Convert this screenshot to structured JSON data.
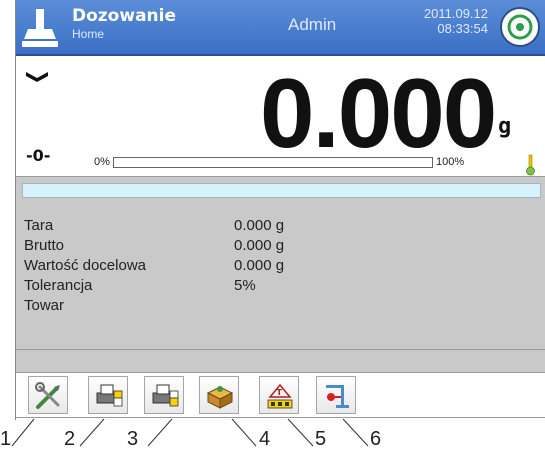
{
  "header": {
    "title": "Dozowanie",
    "subtitle": "Home",
    "user": "Admin",
    "date": "2011.09.12",
    "time": "08:33:54",
    "icon": "dosing-funnel-icon",
    "menu_button_icon": "target-icon",
    "bg_color": "#3a6fc4"
  },
  "display": {
    "weight": "0.000",
    "unit": "g",
    "zero_indicator": "-0-",
    "range_min": "0%",
    "range_max": "100%",
    "bar_level": 0.0,
    "stable_icon": "stability-marker-icon",
    "thermometer_icon": "thermometer-icon"
  },
  "info": {
    "progress_level": 0.0,
    "rows": [
      {
        "label": "Tara",
        "value": "0.000 g"
      },
      {
        "label": "Brutto",
        "value": "0.000 g"
      },
      {
        "label": "Wartość docelowa",
        "value": "0.000 g"
      },
      {
        "label": "Tolerancja",
        "value": "5%"
      },
      {
        "label": "Towar",
        "value": ""
      }
    ]
  },
  "toolbar": {
    "buttons": [
      {
        "icon": "settings-tools-icon"
      },
      {
        "icon": "print-header-icon"
      },
      {
        "icon": "print-footer-icon"
      },
      {
        "icon": "product-database-icon"
      },
      {
        "icon": "tare-database-icon"
      },
      {
        "icon": "dosing-start-icon"
      }
    ]
  },
  "callouts": [
    "1",
    "2",
    "3",
    "4",
    "5",
    "6"
  ]
}
